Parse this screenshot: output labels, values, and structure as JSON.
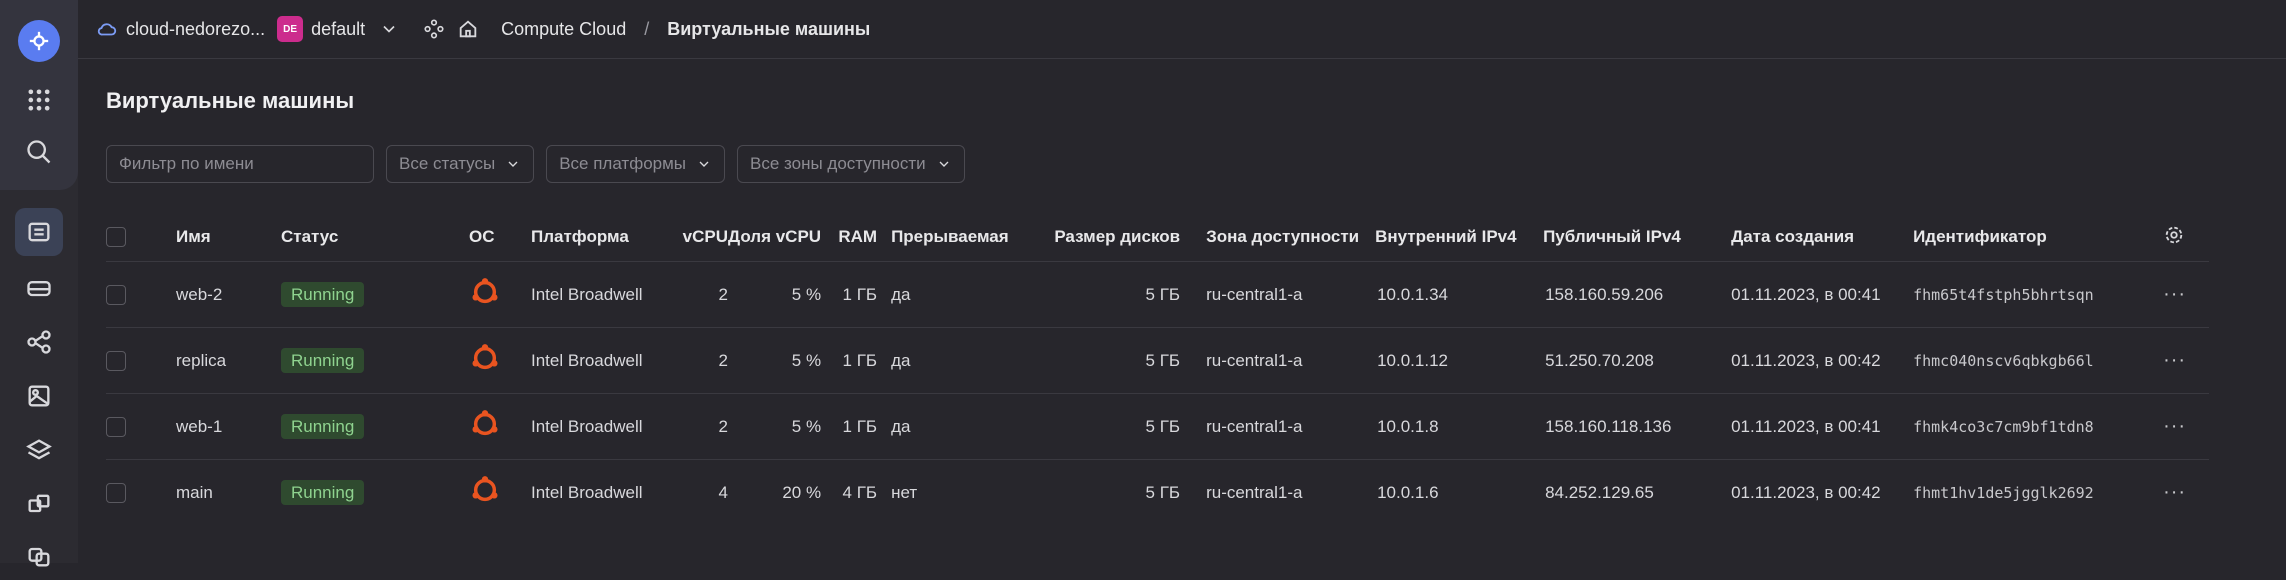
{
  "topbar": {
    "cloud_name": "cloud-nedorezo...",
    "folder_badge": "DE",
    "folder_name": "default",
    "breadcrumb": [
      "Compute Cloud",
      "Виртуальные машины"
    ]
  },
  "page": {
    "title": "Виртуальные машины"
  },
  "filters": {
    "name_placeholder": "Фильтр по имени",
    "status": "Все статусы",
    "platform": "Все платформы",
    "zone": "Все зоны доступности"
  },
  "table": {
    "columns": [
      "Имя",
      "Статус",
      "ОС",
      "Платформа",
      "vCPU",
      "Доля vCPU",
      "RAM",
      "Прерываемая",
      "Размер дисков",
      "Зона доступности",
      "Внутренний IPv4",
      "Публичный IPv4",
      "Дата создания",
      "Идентификатор"
    ],
    "rows": [
      {
        "name": "web-2",
        "status": "Running",
        "platform": "Intel Broadwell",
        "vcpu": "2",
        "share": "5 %",
        "ram": "1 ГБ",
        "preempt": "да",
        "disk": "5 ГБ",
        "zone": "ru-central1-a",
        "ip_int": "10.0.1.34",
        "ip_pub": "158.160.59.206",
        "created": "01.11.2023, в 00:41",
        "id": "fhm65t4fstph5bhrtsqn"
      },
      {
        "name": "replica",
        "status": "Running",
        "platform": "Intel Broadwell",
        "vcpu": "2",
        "share": "5 %",
        "ram": "1 ГБ",
        "preempt": "да",
        "disk": "5 ГБ",
        "zone": "ru-central1-a",
        "ip_int": "10.0.1.12",
        "ip_pub": "51.250.70.208",
        "created": "01.11.2023, в 00:42",
        "id": "fhmc040nscv6qbkgb66l"
      },
      {
        "name": "web-1",
        "status": "Running",
        "platform": "Intel Broadwell",
        "vcpu": "2",
        "share": "5 %",
        "ram": "1 ГБ",
        "preempt": "да",
        "disk": "5 ГБ",
        "zone": "ru-central1-a",
        "ip_int": "10.0.1.8",
        "ip_pub": "158.160.118.136",
        "created": "01.11.2023, в 00:41",
        "id": "fhmk4co3c7cm9bf1tdn8"
      },
      {
        "name": "main",
        "status": "Running",
        "platform": "Intel Broadwell",
        "vcpu": "4",
        "share": "20 %",
        "ram": "4 ГБ",
        "preempt": "нет",
        "disk": "5 ГБ",
        "zone": "ru-central1-a",
        "ip_int": "10.0.1.6",
        "ip_pub": "84.252.129.65",
        "created": "01.11.2023, в 00:42",
        "id": "fhmt1hv1de5jgglk2692"
      }
    ]
  },
  "colors": {
    "accent": "#5a7cf0",
    "badge": "#cc2c8d",
    "status_bg": "#2f4a2f",
    "status_fg": "#8fd38f",
    "os_icon": "#e95420"
  },
  "icons": [
    "logo-icon",
    "apps-grid-icon",
    "search-icon",
    "vm-list-icon",
    "disk-icon",
    "network-icon",
    "image-icon",
    "layers-icon",
    "cubes-icon",
    "ubuntu-icon",
    "settings-icon",
    "more-icon"
  ]
}
